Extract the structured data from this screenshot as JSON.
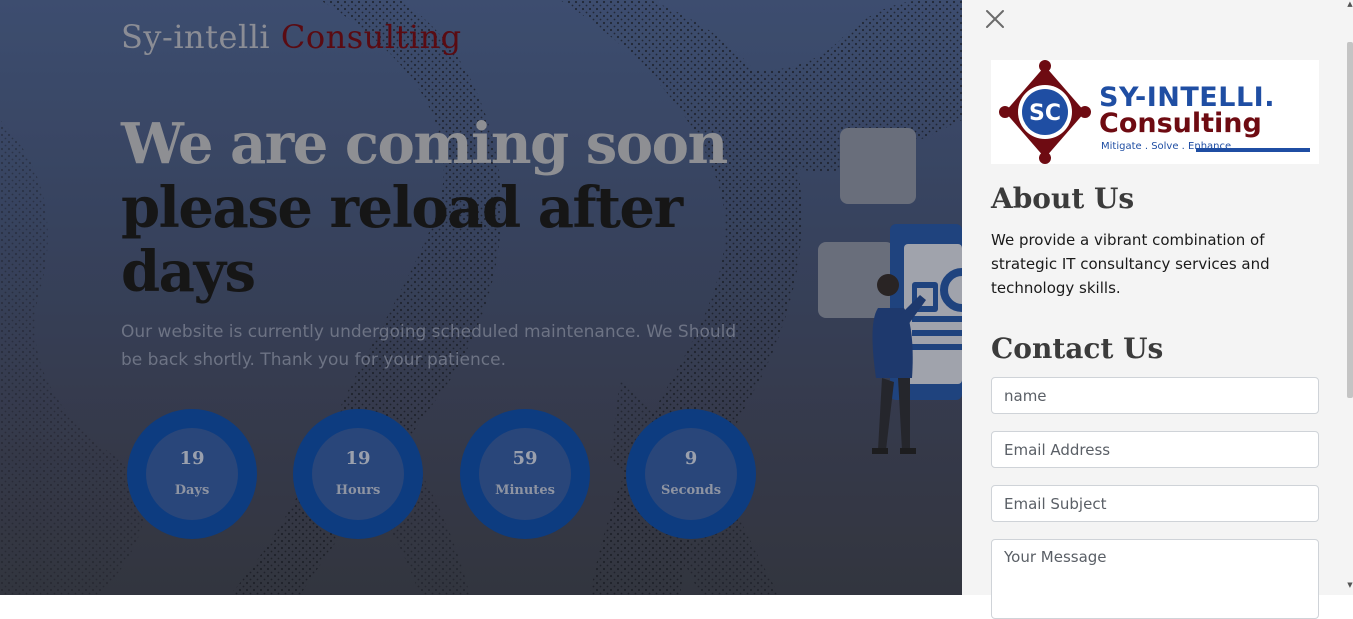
{
  "brand": {
    "part1": "Sy-intelli",
    "part2": "Consulting"
  },
  "hero": {
    "headline_line1": "We are coming soon",
    "headline_line2": "please reload after days",
    "lead": "Our website is currently undergoing scheduled maintenance. We Should be back shortly. Thank you for your patience."
  },
  "countdown": [
    {
      "value": "19",
      "label": "Days"
    },
    {
      "value": "19",
      "label": "Hours"
    },
    {
      "value": "59",
      "label": "Minutes"
    },
    {
      "value": "9",
      "label": "Seconds"
    }
  ],
  "panel": {
    "logo": {
      "initials": "SC",
      "line1": "SY-INTELLI.",
      "line2": "Consulting",
      "tagline": "Mitigate . Solve . Enhance"
    },
    "about_title": "About Us",
    "about_text": "We provide a vibrant combination of strategic IT consultancy services and technology skills.",
    "contact_title": "Contact Us",
    "form": {
      "name_placeholder": "name",
      "email_placeholder": "Email Address",
      "subject_placeholder": "Email Subject",
      "message_placeholder": "Your Message"
    }
  },
  "icons": {
    "close": "close-icon",
    "scroll_up": "scroll-up-arrow-icon",
    "scroll_down": "scroll-down-arrow-icon"
  },
  "colors": {
    "accent_blue": "#0d3c80",
    "brand_red": "#5a0b12",
    "logo_blue": "#1f4ea3"
  }
}
